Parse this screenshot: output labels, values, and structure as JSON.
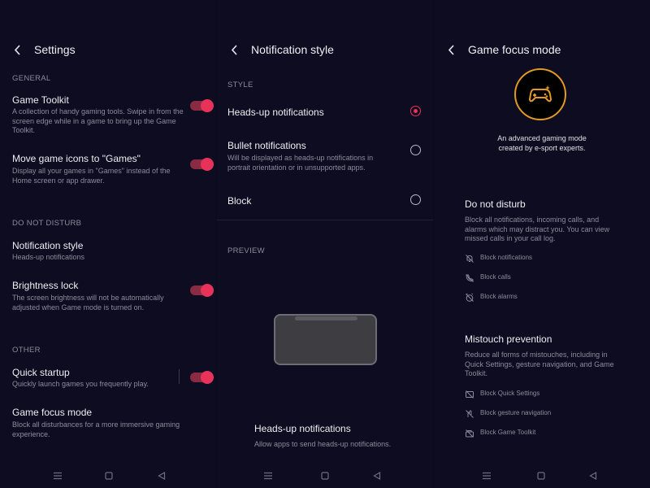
{
  "settings": {
    "title": "Settings",
    "sections": {
      "general": "GENERAL",
      "dnd": "DO NOT DISTURB",
      "other": "OTHER"
    },
    "items": {
      "game_toolkit": {
        "title": "Game Toolkit",
        "desc": "A collection of handy gaming tools. Swipe in from the screen edge while in a game to bring up the Game Toolkit.",
        "enabled": true
      },
      "move_icons": {
        "title": "Move game icons to \"Games\"",
        "desc": "Display all your games in \"Games\" instead of the Home screen or app drawer.",
        "enabled": true
      },
      "notification_style": {
        "title": "Notification style",
        "desc": "Heads-up notifications"
      },
      "brightness_lock": {
        "title": "Brightness lock",
        "desc": "The screen brightness will not be automatically adjusted when Game mode is turned on.",
        "enabled": true
      },
      "quick_startup": {
        "title": "Quick startup",
        "desc": "Quickly launch games you frequently play.",
        "enabled": true
      },
      "game_focus": {
        "title": "Game focus mode",
        "desc": "Block all disturbances for a more immersive gaming experience."
      }
    }
  },
  "notification_style": {
    "title": "Notification style",
    "style_label": "STYLE",
    "options": {
      "headsup": {
        "label": "Heads-up notifications",
        "selected": true
      },
      "bullet": {
        "label": "Bullet notifications",
        "desc": "Will be displayed as heads-up notifications in portrait orientation or in unsupported apps.",
        "selected": false
      },
      "block": {
        "label": "Block",
        "selected": false
      }
    },
    "preview_label": "PREVIEW",
    "preview_title": "Heads-up notifications",
    "preview_desc": "Allow apps to send heads-up notifications."
  },
  "game_focus": {
    "title": "Game focus mode",
    "intro_line1": "An advanced gaming mode",
    "intro_line2": "created by e-sport experts.",
    "dnd": {
      "title": "Do not disturb",
      "desc": "Block all notifications, incoming calls, and alarms which may distract you. You can view missed calls in your call log.",
      "features": [
        "Block notifications",
        "Block calls",
        "Block alarms"
      ]
    },
    "mistouch": {
      "title": "Mistouch prevention",
      "desc": "Reduce all forms of mistouches, including in Quick Settings, gesture navigation, and Game Toolkit.",
      "features": [
        "Block Quick Settings",
        "Block gesture navigation",
        "Block Game Toolkit"
      ]
    }
  },
  "icons": {
    "back": "back-arrow-icon",
    "nav": [
      "menu-icon",
      "home-square-icon",
      "back-triangle-icon"
    ],
    "logo": "gamepad-icon",
    "dnd_features": [
      "notification-off-icon",
      "call-off-icon",
      "alarm-off-icon"
    ],
    "mistouch_features": [
      "quick-settings-off-icon",
      "gesture-off-icon",
      "toolkit-off-icon"
    ]
  },
  "colors": {
    "background": "#0d0c20",
    "accent": "#e8325a",
    "logo_ring": "#e29a25"
  }
}
